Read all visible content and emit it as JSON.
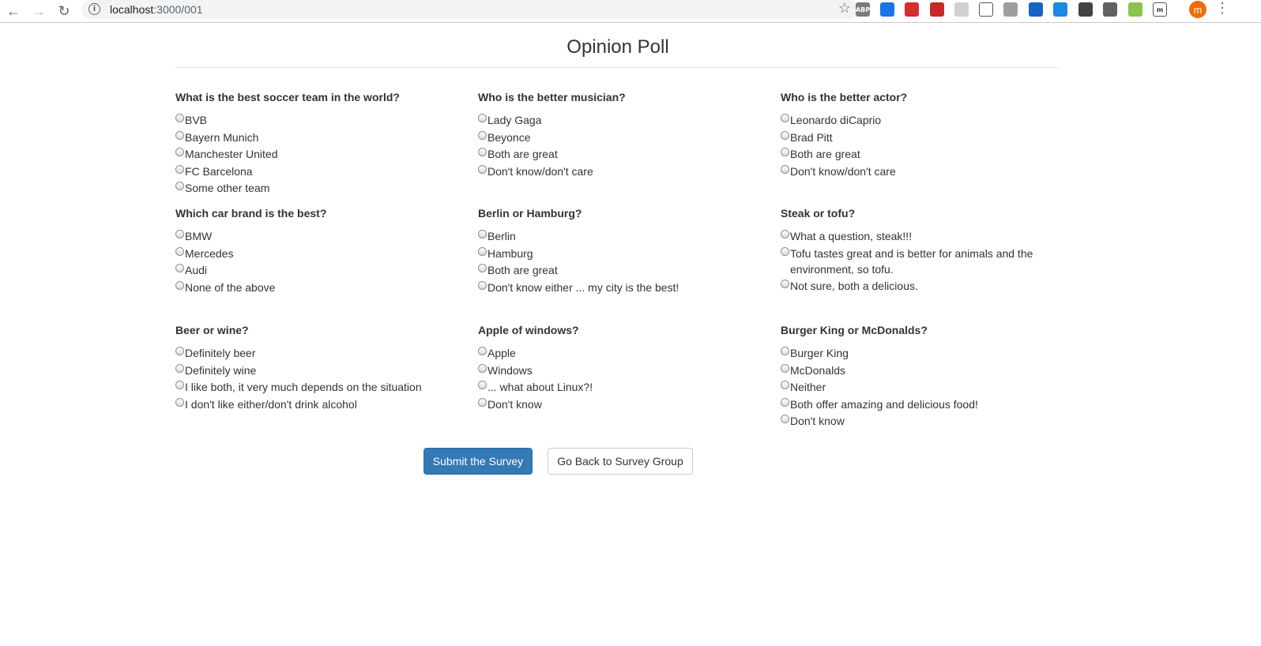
{
  "browser": {
    "url_host": "localhost",
    "url_path": ":3000/001",
    "avatar_letter": "m",
    "extensions": [
      {
        "name": "abp-extension-icon",
        "label": "ABP",
        "color": "#7a7a7a"
      },
      {
        "name": "translate-extension-icon",
        "label": "",
        "color": "#1a73e8"
      },
      {
        "name": "red-play-extension-icon",
        "label": "",
        "color": "#d32f2f"
      },
      {
        "name": "red-tools-extension-icon",
        "label": "",
        "color": "#c62828"
      },
      {
        "name": "circle-extension-icon",
        "label": "",
        "color": "#d0d0d0"
      },
      {
        "name": "screenshot-extension-icon",
        "label": "",
        "color": "#ffffff"
      },
      {
        "name": "vue-extension-icon",
        "label": "",
        "color": "#9e9e9e"
      },
      {
        "name": "window-extension-icon",
        "label": "",
        "color": "#1565c0"
      },
      {
        "name": "chat-extension-icon",
        "label": "",
        "color": "#1e88e5"
      },
      {
        "name": "sync-extension-icon",
        "label": "",
        "color": "#424242"
      },
      {
        "name": "gcircle-extension-icon",
        "label": "",
        "color": "#616161"
      },
      {
        "name": "download-extension-icon",
        "label": "",
        "color": "#8bc34a"
      },
      {
        "name": "m-extension-icon",
        "label": "m",
        "color": "#ffffff"
      }
    ]
  },
  "page": {
    "title": "Opinion Poll"
  },
  "questions": [
    {
      "label": "What is the best soccer team in the world?",
      "options": [
        "BVB",
        "Bayern Munich",
        "Manchester United",
        "FC Barcelona",
        "Some other team"
      ]
    },
    {
      "label": "Who is the better musician?",
      "options": [
        "Lady Gaga",
        "Beyonce",
        "Both are great",
        "Don't know/don't care"
      ]
    },
    {
      "label": "Who is the better actor?",
      "options": [
        "Leonardo diCaprio",
        "Brad Pitt",
        "Both are great",
        "Don't know/don't care"
      ]
    },
    {
      "label": "Which car brand is the best?",
      "options": [
        "BMW",
        "Mercedes",
        "Audi",
        "None of the above"
      ]
    },
    {
      "label": "Berlin or Hamburg?",
      "options": [
        "Berlin",
        "Hamburg",
        "Both are great",
        "Don't know either ... my city is the best!"
      ]
    },
    {
      "label": "Steak or tofu?",
      "options": [
        "What a question, steak!!!",
        "Tofu tastes great and is better for animals and the environment, so tofu.",
        "Not sure, both a delicious."
      ]
    },
    {
      "label": "Beer or wine?",
      "options": [
        "Definitely beer",
        "Definitely wine",
        "I like both, it very much depends on the situation",
        "I don't like either/don't drink alcohol"
      ]
    },
    {
      "label": "Apple of windows?",
      "options": [
        "Apple",
        "Windows",
        "... what about Linux?!",
        "Don't know"
      ]
    },
    {
      "label": "Burger King or McDonalds?",
      "options": [
        "Burger King",
        "McDonalds",
        "Neither",
        "Both offer amazing and delicious food!",
        "Don't know"
      ]
    }
  ],
  "buttons": {
    "submit_label": "Submit the Survey",
    "back_label": "Go Back to Survey Group"
  }
}
